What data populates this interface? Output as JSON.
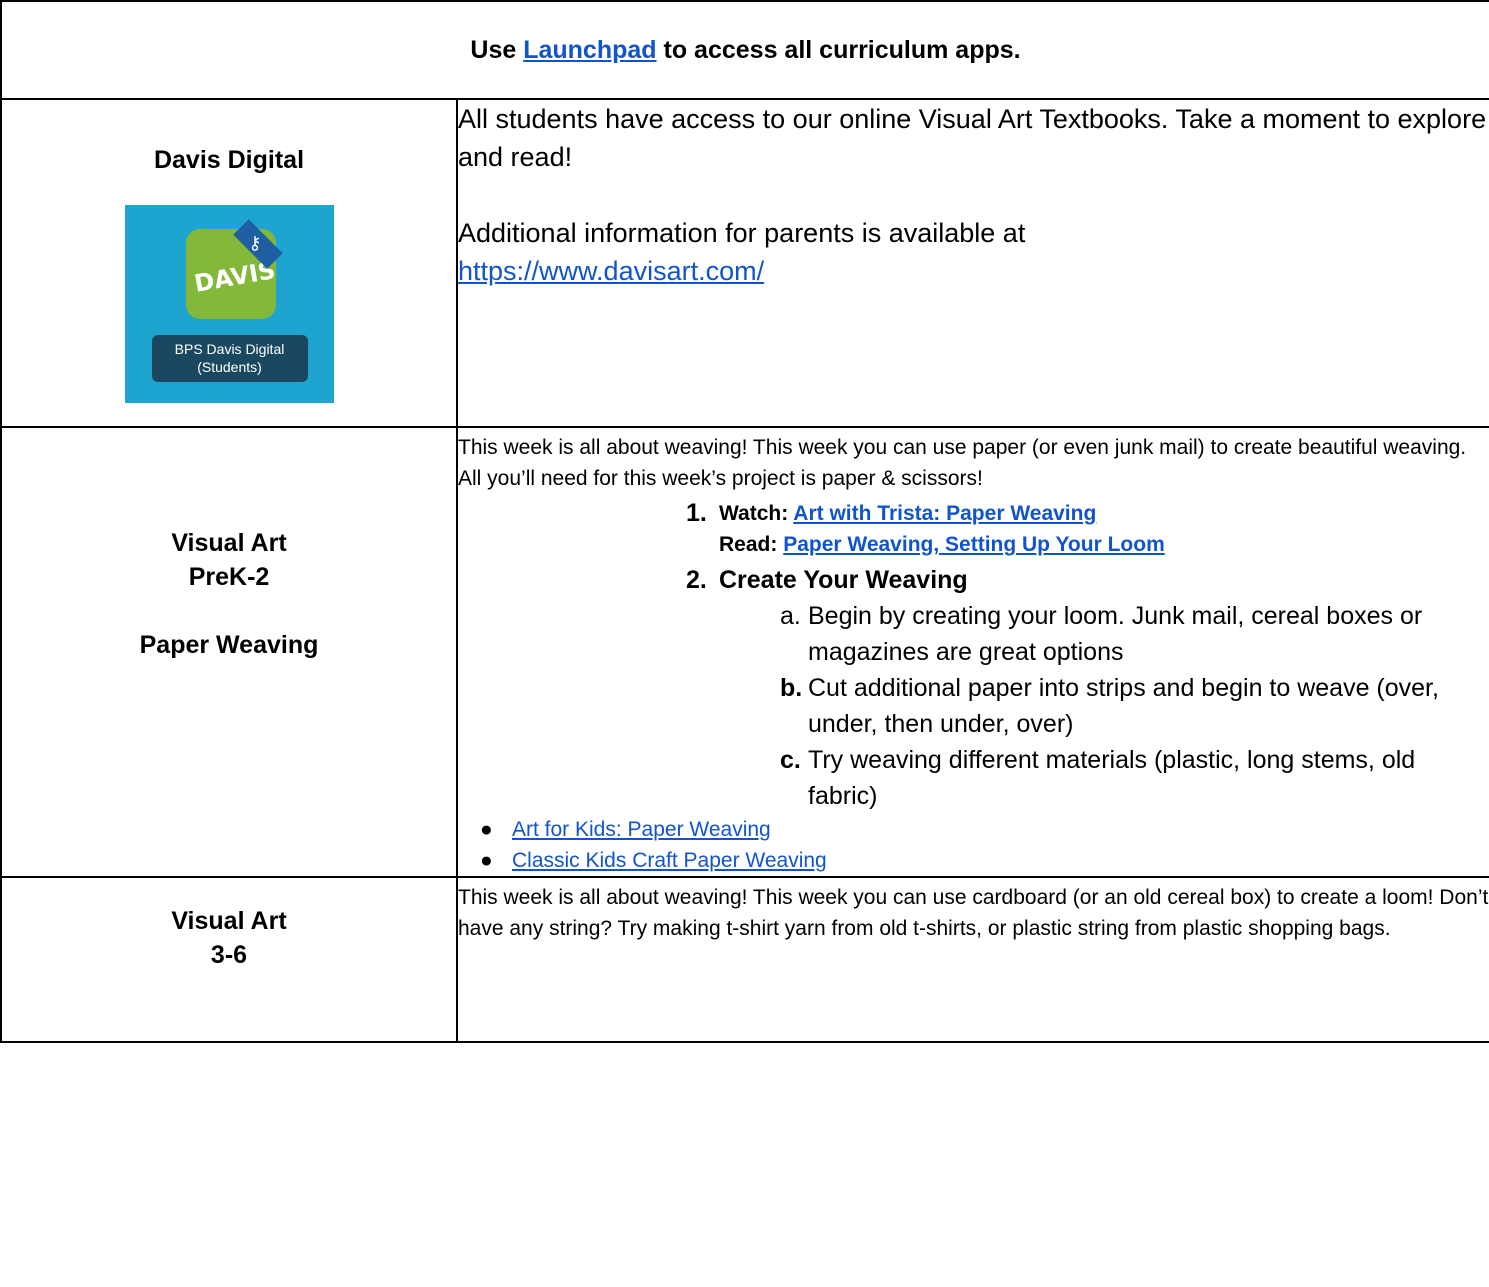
{
  "header": {
    "prefix": "Use ",
    "link": "Launchpad",
    "suffix": " to access all curriculum apps."
  },
  "davis": {
    "title": "Davis Digital",
    "logo_app_text": "DAVIS",
    "logo_label_line1": "BPS Davis Digital",
    "logo_label_line2": "(Students)",
    "text1": "All students have access to our online Visual Art Textbooks. Take a moment to explore and read!",
    "text2": "Additional information for parents is available at",
    "url": "https://www.davisart.com/"
  },
  "prek": {
    "title_line1": "Visual Art",
    "title_line2": "PreK-2",
    "title_line3": "Paper Weaving",
    "intro": "This week is all about weaving! This week you can use paper (or even junk mail) to create beautiful weaving. All you’ll need for this week’s project is paper & scissors!",
    "step1_num": "1.",
    "step1_watch_label": "Watch: ",
    "step1_watch_link": "Art with Trista: Paper Weaving",
    "step1_read_label": "Read: ",
    "step1_read_link": "Paper Weaving, Setting Up Your Loom",
    "step2_num": "2.",
    "step2_title": "Create Your Weaving",
    "sub_a_letter": "a.",
    "sub_a": "Begin by creating your loom. Junk mail, cereal boxes or magazines are great options",
    "sub_b_letter": "b.",
    "sub_b": "Cut additional paper into strips and begin to weave (over, under, then under, over)",
    "sub_c_letter": "c.",
    "sub_c": "Try weaving different materials (plastic, long stems, old fabric)",
    "bullet": "●",
    "link1": "Art for Kids: Paper Weaving",
    "link2": "Classic Kids Craft Paper Weaving"
  },
  "g36": {
    "title_line1": "Visual Art",
    "title_line2": "3-6",
    "text": "This week is all about weaving! This week you can use cardboard (or an old cereal box) to create a loom! Don’t have any string? Try making t-shirt yarn from old t-shirts, or plastic string from plastic shopping bags."
  },
  "colors": {
    "link": "#1155cc",
    "logo_background": "#1ea5cf",
    "logo_app": "#84b83a",
    "logo_label": "#1a4860"
  }
}
